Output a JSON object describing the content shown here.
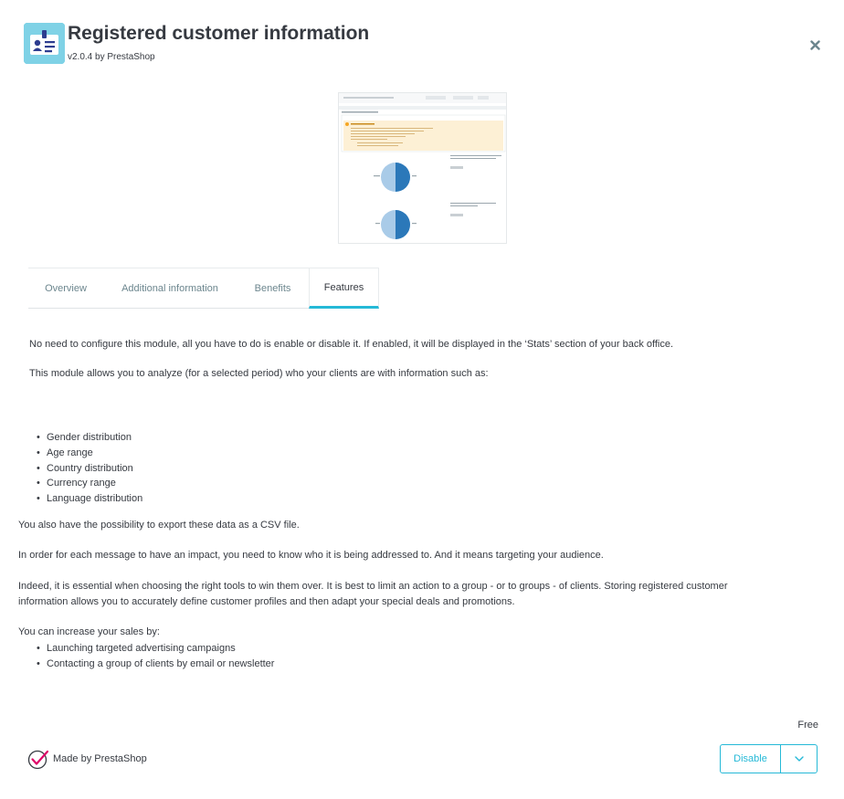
{
  "header": {
    "title": "Registered customer information",
    "subtitle": "v2.0.4 by PrestaShop",
    "logo_icon": "user-card-icon",
    "close_icon": "close-icon"
  },
  "colors": {
    "accent": "#25b9d7",
    "text": "#363a41",
    "muted": "#6c868e"
  },
  "tabs": [
    {
      "label": "Overview",
      "active": false
    },
    {
      "label": "Additional information",
      "active": false
    },
    {
      "label": "Benefits",
      "active": false
    },
    {
      "label": "Features",
      "active": true
    }
  ],
  "features": {
    "intro": "No need to configure this module, all you have to do is enable or disable it. If enabled, it will be displayed in the ‘Stats’ section of your back office.",
    "analyze_intro": "This module allows you to analyze (for a selected period) who your clients are with information such as:",
    "analysis_items": [
      "Gender distribution",
      "Age range",
      "Country distribution",
      "Currency range",
      "Language distribution"
    ],
    "export_note": "You also have the possibility to export these data as a CSV file.",
    "impact_note": "In order for each message to have an impact, you need to know who it is being addressed to. And it means targeting your audience.",
    "essential_line1": "Indeed, it is essential when choosing the right tools to win them over. It is best to limit an action to a group - or to groups - of clients. Storing registered customer",
    "essential_line2": "information allows you to accurately define customer profiles and then adapt your special deals and promotions.",
    "sales_intro": "You can increase your sales by:",
    "sales_items": [
      "Launching targeted advertising campaigns",
      "Contacting a group of clients by email or newsletter"
    ]
  },
  "footer": {
    "price": "Free",
    "made_by": "Made by PrestaShop",
    "disable_label": "Disable",
    "dropdown_icon": "chevron-down-icon"
  }
}
